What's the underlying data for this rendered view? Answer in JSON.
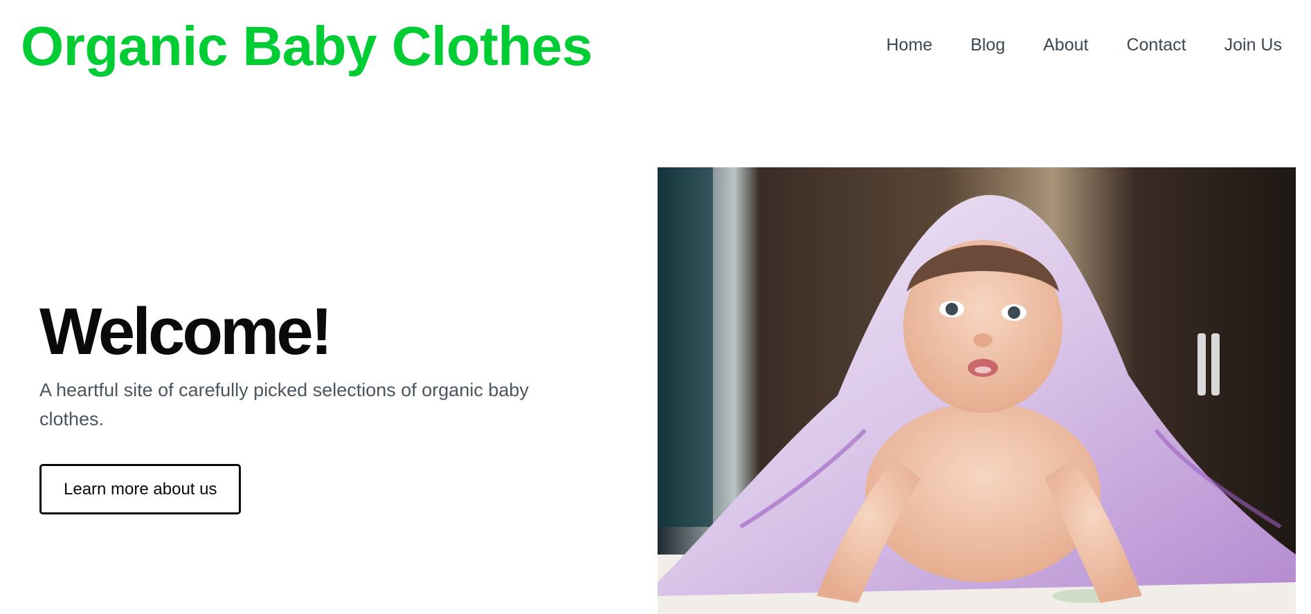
{
  "header": {
    "site_title": "Organic Baby Clothes",
    "nav": [
      {
        "label": "Home"
      },
      {
        "label": "Blog"
      },
      {
        "label": "About"
      },
      {
        "label": "Contact"
      },
      {
        "label": "Join Us"
      }
    ]
  },
  "hero": {
    "heading": "Welcome!",
    "subtitle": "A heartful site of carefully picked selections of organic baby clothes.",
    "cta_label": "Learn more about us",
    "image_description": "baby-photo"
  },
  "colors": {
    "brand_green": "#00cc33",
    "nav_text": "#3b4852",
    "heading_text": "#0a0a0a",
    "body_text": "#4a5560"
  }
}
